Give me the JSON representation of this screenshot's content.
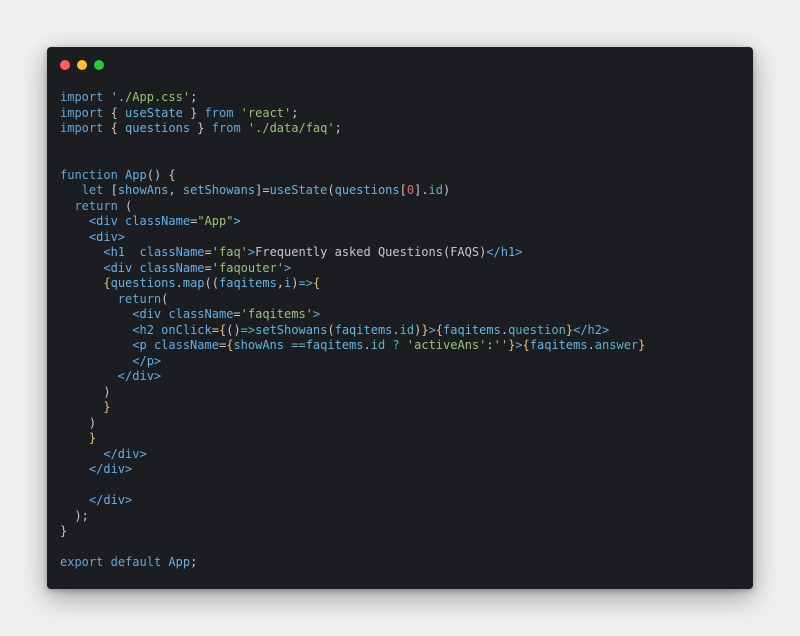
{
  "window": {
    "controls": [
      "close",
      "minimize",
      "maximize"
    ]
  },
  "code_lines": [
    [
      [
        "kw",
        "import"
      ],
      [
        "pun",
        " "
      ],
      [
        "str",
        "'./App.css'"
      ],
      [
        "pun",
        ";"
      ]
    ],
    [
      [
        "kw",
        "import"
      ],
      [
        "pun",
        " { "
      ],
      [
        "id",
        "useState"
      ],
      [
        "pun",
        " } "
      ],
      [
        "kw",
        "from"
      ],
      [
        "pun",
        " "
      ],
      [
        "str",
        "'react'"
      ],
      [
        "pun",
        ";"
      ]
    ],
    [
      [
        "kw",
        "import"
      ],
      [
        "pun",
        " { "
      ],
      [
        "id",
        "questions"
      ],
      [
        "pun",
        " } "
      ],
      [
        "kw",
        "from"
      ],
      [
        "pun",
        " "
      ],
      [
        "str",
        "'./data/faq'"
      ],
      [
        "pun",
        ";"
      ]
    ],
    [],
    [],
    [
      [
        "kw",
        "function"
      ],
      [
        "pun",
        " "
      ],
      [
        "fn",
        "App"
      ],
      [
        "pun",
        "() {"
      ]
    ],
    [
      [
        "pun",
        "   "
      ],
      [
        "kw",
        "let"
      ],
      [
        "pun",
        " ["
      ],
      [
        "id",
        "showAns"
      ],
      [
        "pun",
        ", "
      ],
      [
        "id",
        "setShowans"
      ],
      [
        "pun",
        "]="
      ],
      [
        "fn",
        "useState"
      ],
      [
        "pun",
        "("
      ],
      [
        "id",
        "questions"
      ],
      [
        "pun",
        "["
      ],
      [
        "num",
        "0"
      ],
      [
        "pun",
        "]."
      ],
      [
        "prop",
        "id"
      ],
      [
        "pun",
        ")"
      ]
    ],
    [
      [
        "pun",
        "  "
      ],
      [
        "kw",
        "return"
      ],
      [
        "pun",
        " ("
      ]
    ],
    [
      [
        "pun",
        "    "
      ],
      [
        "tag",
        "<div"
      ],
      [
        "pun",
        " "
      ],
      [
        "attr",
        "className"
      ],
      [
        "pun",
        "="
      ],
      [
        "str",
        "\"App\""
      ],
      [
        "tag",
        ">"
      ]
    ],
    [
      [
        "pun",
        "    "
      ],
      [
        "tag",
        "<div>"
      ]
    ],
    [
      [
        "pun",
        "      "
      ],
      [
        "tag",
        "<h1"
      ],
      [
        "pun",
        "  "
      ],
      [
        "attr",
        "className"
      ],
      [
        "pun",
        "="
      ],
      [
        "str",
        "'faq'"
      ],
      [
        "tag",
        ">"
      ],
      [
        "text",
        "Frequently asked Questions(FAQS)"
      ],
      [
        "tag",
        "</h1>"
      ]
    ],
    [
      [
        "pun",
        "      "
      ],
      [
        "tag",
        "<div"
      ],
      [
        "pun",
        " "
      ],
      [
        "attr",
        "className"
      ],
      [
        "pun",
        "="
      ],
      [
        "str",
        "'faqouter'"
      ],
      [
        "tag",
        ">"
      ]
    ],
    [
      [
        "pun",
        "      "
      ],
      [
        "brace",
        "{"
      ],
      [
        "id",
        "questions"
      ],
      [
        "pun",
        "."
      ],
      [
        "fn",
        "map"
      ],
      [
        "pun",
        "(("
      ],
      [
        "id",
        "faqitems"
      ],
      [
        "pun",
        ","
      ],
      [
        "id",
        "i"
      ],
      [
        "pun",
        ")"
      ],
      [
        "op",
        "=>"
      ],
      [
        "brace",
        "{"
      ]
    ],
    [
      [
        "pun",
        "        "
      ],
      [
        "kw",
        "return"
      ],
      [
        "pun",
        "("
      ]
    ],
    [
      [
        "pun",
        "          "
      ],
      [
        "tag",
        "<div"
      ],
      [
        "pun",
        " "
      ],
      [
        "attr",
        "className"
      ],
      [
        "pun",
        "="
      ],
      [
        "str",
        "'faqitems'"
      ],
      [
        "tag",
        ">"
      ]
    ],
    [
      [
        "pun",
        "          "
      ],
      [
        "tag",
        "<h2"
      ],
      [
        "pun",
        " "
      ],
      [
        "attr",
        "onClick"
      ],
      [
        "pun",
        "="
      ],
      [
        "brace",
        "{"
      ],
      [
        "pun",
        "()"
      ],
      [
        "op",
        "=>"
      ],
      [
        "fn",
        "setShowans"
      ],
      [
        "pun",
        "("
      ],
      [
        "id",
        "faqitems"
      ],
      [
        "pun",
        "."
      ],
      [
        "prop",
        "id"
      ],
      [
        "pun",
        ")"
      ],
      [
        "brace",
        "}"
      ],
      [
        "tag",
        ">"
      ],
      [
        "brace",
        "{"
      ],
      [
        "id",
        "faqitems"
      ],
      [
        "pun",
        "."
      ],
      [
        "prop",
        "question"
      ],
      [
        "brace",
        "}"
      ],
      [
        "tag",
        "</h2>"
      ]
    ],
    [
      [
        "pun",
        "          "
      ],
      [
        "tag",
        "<p"
      ],
      [
        "pun",
        " "
      ],
      [
        "attr",
        "className"
      ],
      [
        "pun",
        "="
      ],
      [
        "brace",
        "{"
      ],
      [
        "id",
        "showAns"
      ],
      [
        "pun",
        " "
      ],
      [
        "op",
        "=="
      ],
      [
        "id",
        "faqitems"
      ],
      [
        "pun",
        "."
      ],
      [
        "prop",
        "id"
      ],
      [
        "pun",
        " "
      ],
      [
        "op",
        "?"
      ],
      [
        "pun",
        " "
      ],
      [
        "str",
        "'activeAns'"
      ],
      [
        "pun",
        ":"
      ],
      [
        "str",
        "''"
      ],
      [
        "brace",
        "}"
      ],
      [
        "tag",
        ">"
      ],
      [
        "brace",
        "{"
      ],
      [
        "id",
        "faqitems"
      ],
      [
        "pun",
        "."
      ],
      [
        "prop",
        "answer"
      ],
      [
        "brace",
        "}"
      ]
    ],
    [
      [
        "pun",
        "          "
      ],
      [
        "tag",
        "</p>"
      ]
    ],
    [
      [
        "pun",
        "        "
      ],
      [
        "tag",
        "</div>"
      ]
    ],
    [
      [
        "pun",
        "      )"
      ]
    ],
    [
      [
        "pun",
        "      "
      ],
      [
        "brace",
        "}"
      ]
    ],
    [
      [
        "pun",
        "    )"
      ]
    ],
    [
      [
        "pun",
        "    "
      ],
      [
        "brace",
        "}"
      ]
    ],
    [
      [
        "pun",
        "      "
      ],
      [
        "tag",
        "</div>"
      ]
    ],
    [
      [
        "pun",
        "    "
      ],
      [
        "tag",
        "</div>"
      ]
    ],
    [],
    [
      [
        "pun",
        "    "
      ],
      [
        "tag",
        "</div>"
      ]
    ],
    [
      [
        "pun",
        "  );"
      ]
    ],
    [
      [
        "pun",
        "}"
      ]
    ],
    [],
    [
      [
        "kw",
        "export"
      ],
      [
        "pun",
        " "
      ],
      [
        "kw",
        "default"
      ],
      [
        "pun",
        " "
      ],
      [
        "fn",
        "App"
      ],
      [
        "pun",
        ";"
      ]
    ]
  ],
  "colors": {
    "page_background": "#f0f0f1",
    "editor_background": "#1c1d20",
    "close_dot": "#ff5f56",
    "minimize_dot": "#ffbd2e",
    "maximize_dot": "#27c93f"
  }
}
